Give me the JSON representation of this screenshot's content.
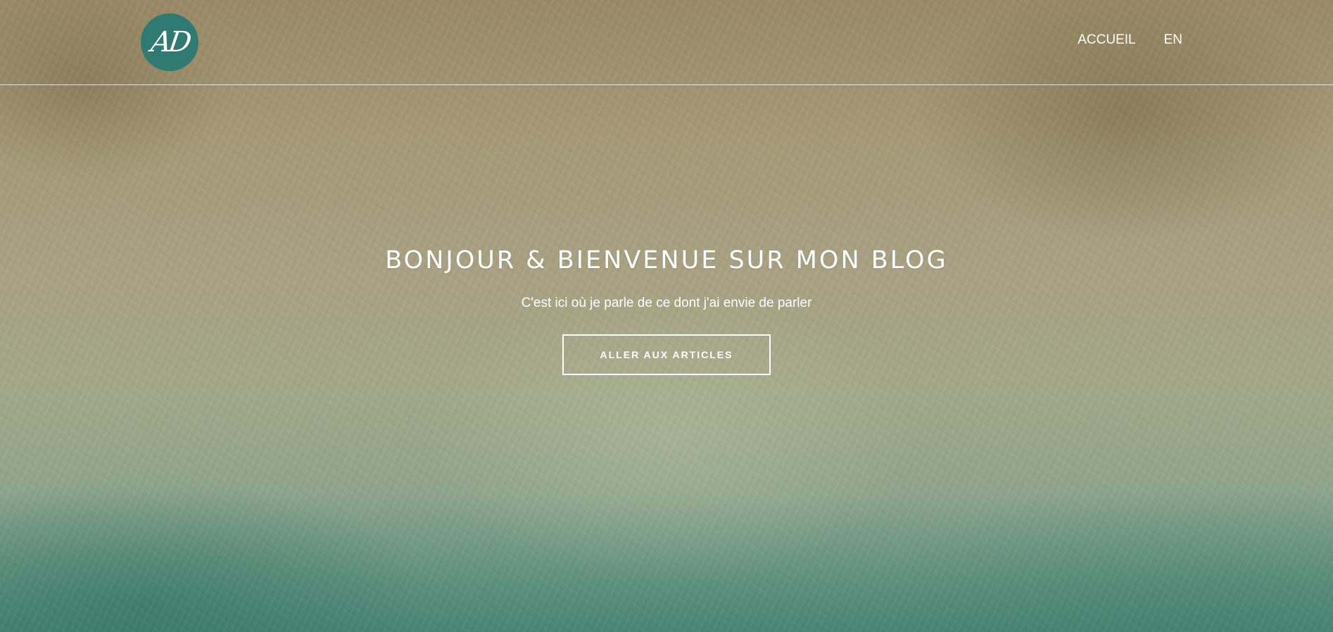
{
  "brand": {
    "logo_text": "AD",
    "logo_color": "#2f7b72"
  },
  "nav": {
    "items": [
      {
        "label": "ACCUEIL"
      },
      {
        "label": "EN"
      }
    ]
  },
  "hero": {
    "title": "BONJOUR & BIENVENUE SUR MON BLOG",
    "subtitle": "C'est ici où je parle de ce dont j'ai envie de parler",
    "cta_label": "ALLER AUX ARTICLES"
  }
}
